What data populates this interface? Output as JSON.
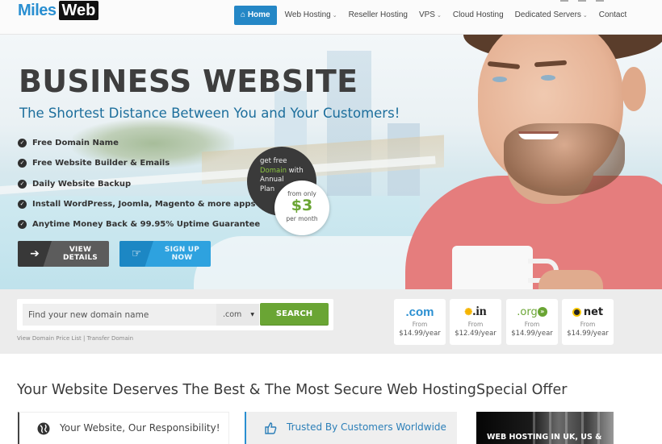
{
  "brand": {
    "logo_part1": "Miles",
    "logo_part2": "Web",
    "accent": "#2487c6",
    "green": "#6aa534"
  },
  "nav": {
    "items": [
      {
        "label": "Home",
        "icon": "home-icon",
        "active": true
      },
      {
        "label": "Web Hosting",
        "has_dropdown": true
      },
      {
        "label": "Reseller Hosting"
      },
      {
        "label": "VPS",
        "has_dropdown": true
      },
      {
        "label": "Cloud Hosting"
      },
      {
        "label": "Dedicated Servers",
        "has_dropdown": true
      },
      {
        "label": "Contact"
      }
    ],
    "caret": "⌄"
  },
  "hero": {
    "title": "BUSINESS WEBSITE",
    "subtitle": "The Shortest Distance Between You and Your Customers!",
    "features": [
      "Free Domain Name",
      "Free Website Builder & Emails",
      "Daily Website Backup",
      "Install WordPress, Joomla, Magento & more apps",
      "Anytime Money Back & 99.95% Uptime Guarantee"
    ],
    "promo": {
      "line1": "get free",
      "highlight": "Domain",
      "line2_rest": " with",
      "line3": "Annual",
      "line4": "Plan",
      "price_prefix": "from only",
      "price": "$3",
      "price_suffix": "per month"
    },
    "buttons": {
      "details": "VIEW DETAILS",
      "signup": "SIGN UP NOW"
    }
  },
  "domain_search": {
    "placeholder": "Find your new domain name",
    "tld_selected": ".com",
    "button": "SEARCH",
    "link_price_list": "View Domain Price List",
    "separator": " | ",
    "link_transfer": "Transfer Domain",
    "tlds": [
      {
        "name": ".com",
        "from": "From",
        "price": "$14.99/year"
      },
      {
        "name": ".in",
        "from": "From",
        "price": "$12.49/year"
      },
      {
        "name": ".org",
        "from": "From",
        "price": "$14.99/year"
      },
      {
        "name": "net",
        "from": "From",
        "price": "$14.99/year"
      }
    ]
  },
  "content": {
    "heading": "Your Website Deserves The Best & The Most Secure Web Hosting",
    "cards": [
      {
        "title": "Your Website, Our Responsibility!",
        "icon": "globe-icon"
      },
      {
        "title": "Trusted By Customers Worldwide",
        "icon": "thumbs-up-icon"
      }
    ]
  },
  "sidebar": {
    "heading": "Special Offer",
    "banner_text": "WEB HOSTING IN UK, US &"
  }
}
